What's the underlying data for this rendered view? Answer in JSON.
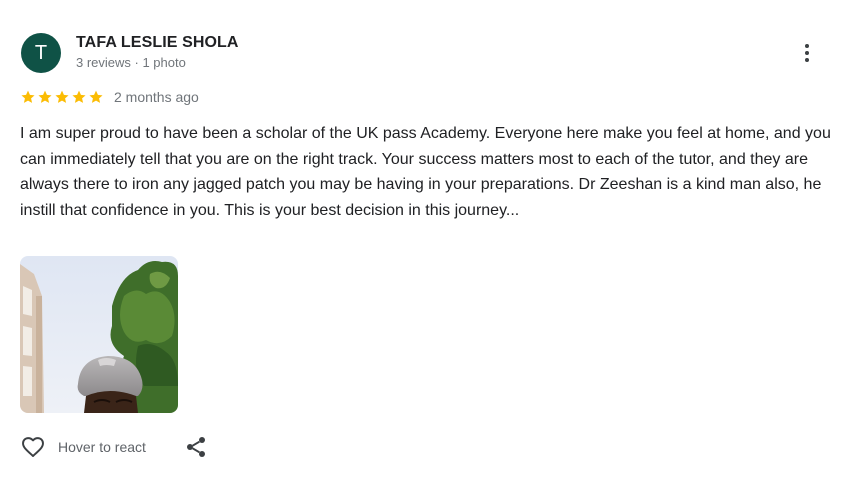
{
  "reviewer": {
    "initial": "T",
    "name": "TAFA LESLIE SHOLA",
    "meta": "3 reviews · 1 photo",
    "avatar_color": "#0f5246"
  },
  "review": {
    "rating": 5,
    "max_rating": 5,
    "date": "2 months ago",
    "text": "I am super proud to have been a scholar of the UK pass Academy. Everyone here make you feel at home, and you can immediately tell that you are on the right track. Your success matters most to each of the tutor, and they are always there to iron any jagged patch you may be having in your preparations. Dr Zeeshan is a kind man also, he instill that confidence in you. This is your best decision in this journey...",
    "star_color": "#fbbc04"
  },
  "actions": {
    "react_label": "Hover to react",
    "react_icon": "heart-outline-icon",
    "share_icon": "share-icon",
    "more_icon": "more-vertical-icon"
  }
}
